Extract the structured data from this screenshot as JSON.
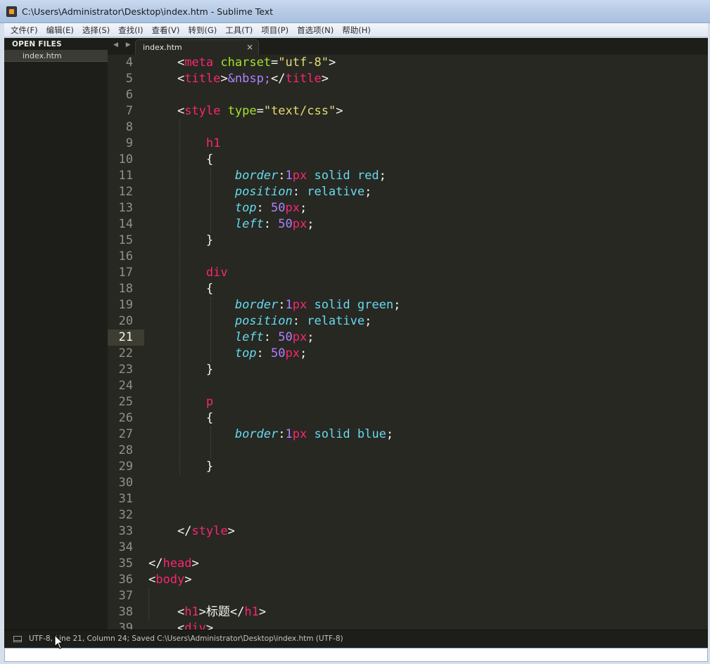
{
  "window": {
    "title": "C:\\Users\\Administrator\\Desktop\\index.htm - Sublime Text"
  },
  "menubar": {
    "items": [
      "文件(F)",
      "编辑(E)",
      "选择(S)",
      "查找(I)",
      "查看(V)",
      "转到(G)",
      "工具(T)",
      "项目(P)",
      "首选项(N)",
      "帮助(H)"
    ]
  },
  "sidebar": {
    "header": "OPEN FILES",
    "files": [
      "index.htm"
    ]
  },
  "tabs": {
    "nav_arrows": "◀ ▶",
    "active": "index.htm",
    "close_glyph": "×"
  },
  "editor": {
    "current_line": 21,
    "line_numbers": [
      "4",
      "5",
      "6",
      "7",
      "8",
      "9",
      "10",
      "11",
      "12",
      "13",
      "14",
      "15",
      "16",
      "17",
      "18",
      "19",
      "20",
      "21",
      "22",
      "23",
      "24",
      "25",
      "26",
      "27",
      "28",
      "29",
      "30",
      "31",
      "32",
      "33",
      "34",
      "35",
      "36",
      "37",
      "38",
      "39"
    ]
  },
  "status": {
    "text": "UTF-8, Line 21, Column 24; Saved C:\\Users\\Administrator\\Desktop\\index.htm (UTF-8)"
  },
  "colors": {
    "background": "#272822",
    "tag": "#f92672",
    "attribute": "#a6e22e",
    "string": "#e6db74",
    "number": "#ae81ff",
    "property": "#66d9ef"
  }
}
